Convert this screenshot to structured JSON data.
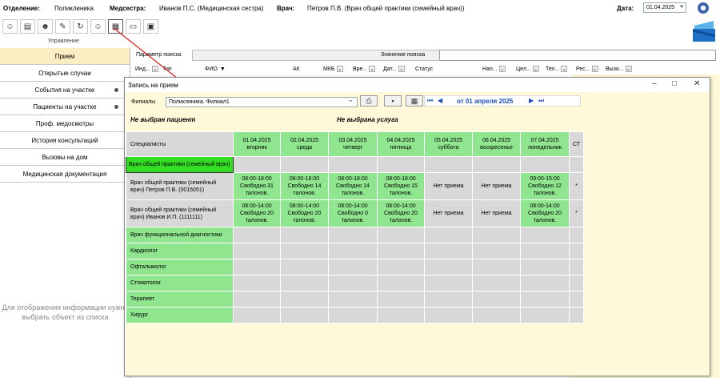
{
  "top": {
    "department_label": "Отделение:",
    "department_value": "Поликлиника",
    "nurse_label": "Медсестра:",
    "nurse_value": "Иванов П.С. (Медицинская сестра)",
    "doctor_label": "Врач:",
    "doctor_value": "Петров П.В. (Врач общей практики (семейный врач))",
    "date_label": "Дата:",
    "date_value": "01.04.2025"
  },
  "toolbar": {
    "section_label": "Управление",
    "buttons": [
      "user-add-icon",
      "card-icon",
      "users-icon",
      "edit-icon",
      "refresh-icon",
      "user-remove-icon",
      "calendar-icon",
      "archive-icon",
      "document-icon"
    ]
  },
  "sidebar": {
    "items": [
      {
        "label": "Прием"
      },
      {
        "label": "Открытые случаи"
      },
      {
        "label": "События на участке"
      },
      {
        "label": "Пациенты на участке"
      },
      {
        "label": "Проф. медосмотры"
      },
      {
        "label": "История консультаций"
      },
      {
        "label": "Вызовы на дом"
      },
      {
        "label": "Медицинская документация"
      }
    ],
    "hint": "Для отображения информации нужно выбрать объект из списка"
  },
  "search": {
    "param_label": "Параметр поиска",
    "value_label": "Значение поиска"
  },
  "columns": [
    "Инд...",
    "Тип",
    "ФИО",
    "АК",
    "МКБ",
    "Вре...",
    "Дат...",
    "Статус",
    "Нап...",
    "Цел...",
    "Тел...",
    "Рес...",
    "Вызо..."
  ],
  "dialog": {
    "title": "Запись на прием",
    "branch_label": "Филиалы",
    "branch_value": "Поликлиника. Филиал1",
    "period": "от 01 апреля 2025",
    "no_patient": "Не выбран пациент",
    "no_service": "Не выбрана услуга",
    "spec_header": "Специалисты",
    "st_header": "СТ",
    "days": [
      {
        "date": "01.04.2025",
        "weekday": "вторник"
      },
      {
        "date": "02.04.2025",
        "weekday": "среда"
      },
      {
        "date": "03.04.2025",
        "weekday": "четверг"
      },
      {
        "date": "04.04.2025",
        "weekday": "пятница"
      },
      {
        "date": "05.04.2025",
        "weekday": "суббота"
      },
      {
        "date": "06.04.2025",
        "weekday": "воскресенье"
      },
      {
        "date": "07.04.2025",
        "weekday": "понедельник"
      }
    ],
    "rows": [
      {
        "name": "Врач общей практики (семейный врач)",
        "kind": "selected",
        "cells": [
          "",
          "",
          "",
          "",
          "",
          "",
          ""
        ],
        "st": ""
      },
      {
        "name": "Врач общей практики (семейный врач) Петров П.В. (0015051)",
        "kind": "doctor",
        "cells": [
          "08:00-18:00 Свободно 31 талонов.",
          "08:00-18:00 Свободно 14 талонов.",
          "08:00-18:00 Свободно 14 талонов.",
          "08:00-18:00 Свободно 15 талонов.",
          "Нет приема",
          "Нет приема",
          "09:00-15:00 Свободно 12 талонов."
        ],
        "st": "*"
      },
      {
        "name": "Врач общей практики (семейный врач) Иванов И.П. (1111111)",
        "kind": "doctor",
        "cells": [
          "08:00-14:00 Свободно 20 талонов.",
          "08:00-14:00 Свободно 20 талонов.",
          "08:00-14:00 Свободно 0 талонов.",
          "08:00-14:00 Свободно 20 талонов.",
          "Нет приема",
          "Нет приема",
          "08:00-14:00 Свободно 20 талонов."
        ],
        "st": "*"
      },
      {
        "name": "Врач функциональной диагностики",
        "kind": "group",
        "cells": [
          "",
          "",
          "",
          "",
          "",
          "",
          ""
        ],
        "st": ""
      },
      {
        "name": "Кардиолог",
        "kind": "group",
        "cells": [
          "",
          "",
          "",
          "",
          "",
          "",
          ""
        ],
        "st": ""
      },
      {
        "name": "Офтальмолог",
        "kind": "group",
        "cells": [
          "",
          "",
          "",
          "",
          "",
          "",
          ""
        ],
        "st": ""
      },
      {
        "name": "Стоматолог",
        "kind": "group",
        "cells": [
          "",
          "",
          "",
          "",
          "",
          "",
          ""
        ],
        "st": ""
      },
      {
        "name": "Терапевт",
        "kind": "group",
        "cells": [
          "",
          "",
          "",
          "",
          "",
          "",
          ""
        ],
        "st": ""
      },
      {
        "name": "Хирург",
        "kind": "group",
        "cells": [
          "",
          "",
          "",
          "",
          "",
          "",
          ""
        ],
        "st": ""
      }
    ]
  },
  "colors": {
    "green": "#8fe68f",
    "grey": "#d8d8d8",
    "panel": "#fff9d9",
    "accent": "#1a4ec0"
  }
}
